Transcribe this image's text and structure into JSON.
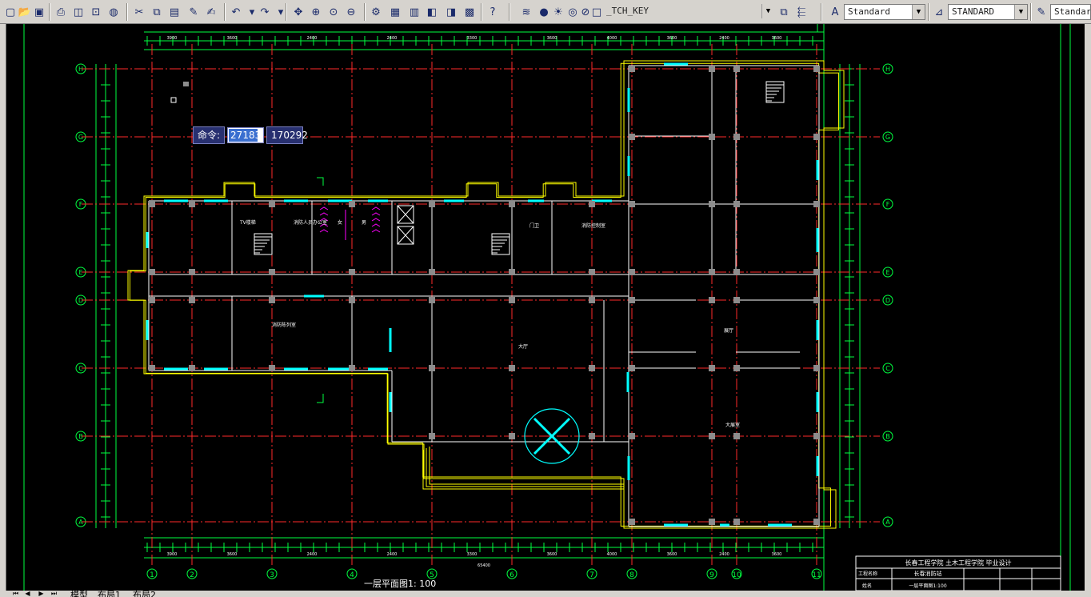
{
  "toolbar": {
    "layer_value": "_TCH_KEY",
    "text_style_value": "Standard",
    "dim_style_value": "STANDARD",
    "table_style_value": "Standard"
  },
  "command": {
    "label": "命令:",
    "x_value": "27183",
    "y_value": "170292"
  },
  "tabs": {
    "model": "模型",
    "layout1": "布局1",
    "layout2": "布局2"
  },
  "drawing": {
    "caption": "一层平面图1: 100",
    "axis_labels_x": [
      "1",
      "2",
      "3",
      "4",
      "5",
      "6",
      "7",
      "8",
      "9",
      "10",
      "11"
    ],
    "axis_labels_y": [
      "H",
      "G",
      "F",
      "E",
      "D",
      "C",
      "B",
      "A"
    ],
    "total_dimension": "65400",
    "room_labels": [
      "TV楼梯",
      "消防人员办公室",
      "女",
      "男",
      "门卫",
      "消防控制室",
      "大厅",
      "消防陈列室",
      "展厅",
      "大展室"
    ],
    "title_block": {
      "header": "长春工程学院 土木工程学院 毕业设计",
      "project_label": "工程名称",
      "project_name": "长春消防站",
      "sheet": "一层平面图1:100",
      "name_label": "姓名"
    }
  },
  "colors": {
    "background": "#000000",
    "axis_red": "#ff2a2a",
    "dim_green": "#00ff40",
    "wall_white": "#ffffff",
    "column_grey": "#8c8c8c",
    "window_cyan": "#00ffff",
    "outline_yellow": "#ffff00",
    "stair_magenta": "#ff00ff",
    "cmd_bg": "#283070"
  }
}
